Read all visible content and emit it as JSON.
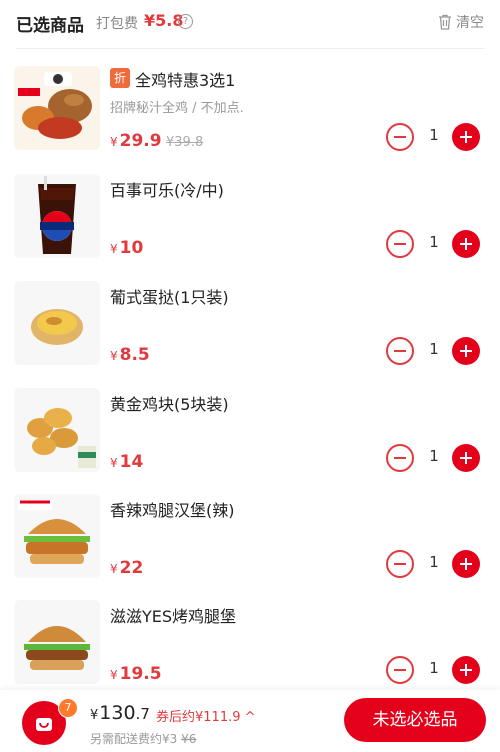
{
  "header": {
    "title": "已选商品",
    "pack_label": "打包费",
    "pack_price": "¥5.8",
    "help_icon": "question-circle-icon",
    "clear_label": "清空",
    "clear_icon": "trash-icon"
  },
  "items": [
    {
      "name": "全鸡特惠3选1",
      "tag": "折",
      "subtitle": "招牌秘汁全鸡 / 不加点.",
      "yen": "¥",
      "price": "29.9",
      "original_price": "¥39.8",
      "qty": "1"
    },
    {
      "name": "百事可乐(冷/中)",
      "yen": "¥",
      "price": "10",
      "qty": "1"
    },
    {
      "name": "葡式蛋挞(1只装)",
      "yen": "¥",
      "price": "8.5",
      "qty": "1"
    },
    {
      "name": "黄金鸡块(5块装)",
      "yen": "¥",
      "price": "14",
      "qty": "1"
    },
    {
      "name": "香辣鸡腿汉堡(辣)",
      "yen": "¥",
      "price": "22",
      "qty": "1"
    },
    {
      "name": "滋滋YES烤鸡腿堡",
      "yen": "¥",
      "price": "19.5",
      "qty": "1"
    }
  ],
  "footer": {
    "cart_badge": "7",
    "total_yen": "¥",
    "total_int": "130",
    "total_dec": ".7",
    "coupon_text": "券后约¥111.9",
    "coupon_icon": "chevron-up-icon",
    "delivery_prefix": "另需配送费约¥3",
    "delivery_old": "¥6",
    "checkout_label": "未选必选品"
  },
  "colors": {
    "accent": "#e4001b",
    "price": "#e4393c",
    "badge": "#ff7a2b",
    "tag": "#f06b3c"
  }
}
